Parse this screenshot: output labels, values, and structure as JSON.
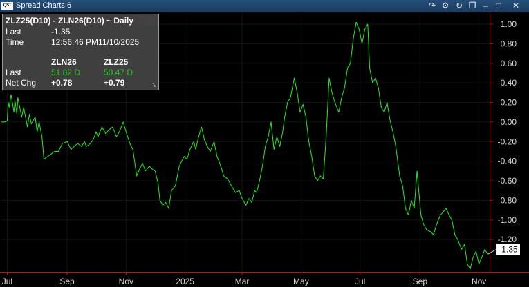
{
  "window": {
    "logo": "QST",
    "title": "Spread Charts 6",
    "icons": [
      "link-icon",
      "gear-icon",
      "refresh-icon",
      "copy-icon",
      "minimize-icon",
      "maximize-icon",
      "close-icon"
    ]
  },
  "info_panel": {
    "title": "ZLZ25(D10) - ZLN26(D10) ~ Daily",
    "last_label": "Last",
    "last_value": "-1.35",
    "time_label": "Time",
    "time_value": "12:56:46 PM11/10/2025",
    "col1_header": "ZLN26",
    "col2_header": "ZLZ25",
    "row_last_label": "Last",
    "col1_last": "51.82 D",
    "col2_last": "50.47 D",
    "row_netchg_label": "Net Chg",
    "col1_netchg": "+0.78",
    "col2_netchg": "+0.79"
  },
  "colors": {
    "background": "#000000",
    "line": "#22ee22",
    "axis": "#b01818",
    "label": "#d8d8d8",
    "grid": "#141414"
  },
  "chart_data": {
    "type": "line",
    "y_axis_side": "right",
    "ylim": [
      -1.53,
      1.12
    ],
    "yticks": [
      "1.00",
      "0.80",
      "0.60",
      "0.40",
      "0.20",
      "0.00",
      "-0.20",
      "-0.40",
      "-0.60",
      "-0.80",
      "-1.00",
      "-1.20"
    ],
    "ytick_values": [
      1.0,
      0.8,
      0.6,
      0.4,
      0.2,
      0.0,
      -0.2,
      -0.4,
      -0.6,
      -0.8,
      -1.0,
      -1.2
    ],
    "x_range": [
      "2024-06-25",
      "2025-11-12"
    ],
    "xticks": [
      {
        "label": "Jul",
        "date": "2024-07-01"
      },
      {
        "label": "Sep",
        "date": "2024-09-01"
      },
      {
        "label": "Nov",
        "date": "2024-11-01"
      },
      {
        "label": "2025",
        "date": "2025-01-01"
      },
      {
        "label": "Mar",
        "date": "2025-03-01"
      },
      {
        "label": "May",
        "date": "2025-05-01"
      },
      {
        "label": "Jul",
        "date": "2025-07-01"
      },
      {
        "label": "Sep",
        "date": "2025-09-01"
      },
      {
        "label": "Nov",
        "date": "2025-11-01"
      }
    ],
    "last_label": "-1.35",
    "last_value": -1.35,
    "series": [
      {
        "points": [
          [
            "2024-06-25",
            0.0
          ],
          [
            "2024-06-28",
            0.0
          ],
          [
            "2024-07-01",
            0.01
          ],
          [
            "2024-07-02",
            0.2
          ],
          [
            "2024-07-03",
            0.15
          ],
          [
            "2024-07-05",
            0.28
          ],
          [
            "2024-07-08",
            0.1
          ],
          [
            "2024-07-09",
            0.22
          ],
          [
            "2024-07-11",
            0.08
          ],
          [
            "2024-07-12",
            0.25
          ],
          [
            "2024-07-16",
            0.05
          ],
          [
            "2024-07-18",
            0.15
          ],
          [
            "2024-07-22",
            -0.05
          ],
          [
            "2024-07-24",
            0.08
          ],
          [
            "2024-07-26",
            -0.02
          ],
          [
            "2024-07-30",
            0.05
          ],
          [
            "2024-08-01",
            -0.1
          ],
          [
            "2024-08-03",
            0.0
          ],
          [
            "2024-08-06",
            -0.15
          ],
          [
            "2024-08-08",
            -0.38
          ],
          [
            "2024-08-12",
            -0.35
          ],
          [
            "2024-08-15",
            -0.33
          ],
          [
            "2024-08-19",
            -0.3
          ],
          [
            "2024-08-23",
            -0.3
          ],
          [
            "2024-08-27",
            -0.22
          ],
          [
            "2024-09-01",
            -0.2
          ],
          [
            "2024-09-05",
            -0.28
          ],
          [
            "2024-09-08",
            -0.25
          ],
          [
            "2024-09-12",
            -0.22
          ],
          [
            "2024-09-16",
            -0.25
          ],
          [
            "2024-09-19",
            -0.2
          ],
          [
            "2024-09-21",
            -0.25
          ],
          [
            "2024-09-25",
            -0.22
          ],
          [
            "2024-09-28",
            -0.18
          ],
          [
            "2024-10-01",
            -0.1
          ],
          [
            "2024-10-03",
            -0.15
          ],
          [
            "2024-10-07",
            -0.05
          ],
          [
            "2024-10-11",
            -0.12
          ],
          [
            "2024-10-14",
            -0.08
          ],
          [
            "2024-10-18",
            -0.05
          ],
          [
            "2024-10-22",
            -0.15
          ],
          [
            "2024-10-25",
            -0.1
          ],
          [
            "2024-10-29",
            0.0
          ],
          [
            "2024-11-01",
            -0.1
          ],
          [
            "2024-11-05",
            -0.22
          ],
          [
            "2024-11-08",
            -0.28
          ],
          [
            "2024-11-12",
            -0.55
          ],
          [
            "2024-11-15",
            -0.48
          ],
          [
            "2024-11-18",
            -0.42
          ],
          [
            "2024-11-21",
            -0.5
          ],
          [
            "2024-11-25",
            -0.45
          ],
          [
            "2024-11-28",
            -0.48
          ],
          [
            "2024-12-01",
            -0.5
          ],
          [
            "2024-12-04",
            -0.62
          ],
          [
            "2024-12-06",
            -0.8
          ],
          [
            "2024-12-09",
            -0.85
          ],
          [
            "2024-12-12",
            -0.82
          ],
          [
            "2024-12-15",
            -0.88
          ],
          [
            "2024-12-18",
            -0.7
          ],
          [
            "2024-12-22",
            -0.65
          ],
          [
            "2024-12-26",
            -0.45
          ],
          [
            "2024-12-31",
            -0.35
          ],
          [
            "2025-01-03",
            -0.38
          ],
          [
            "2025-01-06",
            -0.28
          ],
          [
            "2025-01-10",
            -0.2
          ],
          [
            "2025-01-12",
            -0.28
          ],
          [
            "2025-01-15",
            -0.15
          ],
          [
            "2025-01-18",
            -0.05
          ],
          [
            "2025-01-21",
            -0.18
          ],
          [
            "2025-01-24",
            -0.25
          ],
          [
            "2025-01-27",
            -0.3
          ],
          [
            "2025-01-31",
            -0.2
          ],
          [
            "2025-02-03",
            -0.35
          ],
          [
            "2025-02-07",
            -0.45
          ],
          [
            "2025-02-10",
            -0.55
          ],
          [
            "2025-02-14",
            -0.58
          ],
          [
            "2025-02-18",
            -0.65
          ],
          [
            "2025-02-22",
            -0.72
          ],
          [
            "2025-02-26",
            -0.7
          ],
          [
            "2025-03-01",
            -0.78
          ],
          [
            "2025-03-05",
            -0.85
          ],
          [
            "2025-03-08",
            -0.78
          ],
          [
            "2025-03-11",
            -0.82
          ],
          [
            "2025-03-14",
            -0.7
          ],
          [
            "2025-03-16",
            -0.72
          ],
          [
            "2025-03-19",
            -0.6
          ],
          [
            "2025-03-22",
            -0.45
          ],
          [
            "2025-03-25",
            -0.25
          ],
          [
            "2025-03-28",
            -0.15
          ],
          [
            "2025-03-31",
            0.0
          ],
          [
            "2025-04-03",
            -0.28
          ],
          [
            "2025-04-06",
            -0.15
          ],
          [
            "2025-04-09",
            -0.25
          ],
          [
            "2025-04-12",
            -0.1
          ],
          [
            "2025-04-14",
            0.05
          ],
          [
            "2025-04-17",
            0.2
          ],
          [
            "2025-04-20",
            0.25
          ],
          [
            "2025-04-24",
            0.45
          ],
          [
            "2025-04-27",
            0.3
          ],
          [
            "2025-04-30",
            0.1
          ],
          [
            "2025-05-03",
            0.18
          ],
          [
            "2025-05-06",
            0.05
          ],
          [
            "2025-05-09",
            -0.2
          ],
          [
            "2025-05-12",
            -0.35
          ],
          [
            "2025-05-15",
            -0.55
          ],
          [
            "2025-05-18",
            -0.6
          ],
          [
            "2025-05-21",
            -0.55
          ],
          [
            "2025-05-24",
            -0.58
          ],
          [
            "2025-05-27",
            -0.15
          ],
          [
            "2025-05-30",
            0.45
          ],
          [
            "2025-06-02",
            0.3
          ],
          [
            "2025-06-05",
            0.2
          ],
          [
            "2025-06-09",
            0.1
          ],
          [
            "2025-06-12",
            0.25
          ],
          [
            "2025-06-15",
            0.35
          ],
          [
            "2025-06-18",
            0.55
          ],
          [
            "2025-06-21",
            0.6
          ],
          [
            "2025-06-24",
            0.85
          ],
          [
            "2025-06-27",
            1.02
          ],
          [
            "2025-06-30",
            0.95
          ],
          [
            "2025-07-03",
            0.8
          ],
          [
            "2025-07-06",
            0.95
          ],
          [
            "2025-07-09",
            1.0
          ],
          [
            "2025-07-11",
            0.55
          ],
          [
            "2025-07-14",
            0.4
          ],
          [
            "2025-07-17",
            0.45
          ],
          [
            "2025-07-20",
            0.35
          ],
          [
            "2025-07-23",
            0.15
          ],
          [
            "2025-07-26",
            0.1
          ],
          [
            "2025-07-29",
            0.2
          ],
          [
            "2025-08-01",
            0.02
          ],
          [
            "2025-08-04",
            -0.1
          ],
          [
            "2025-08-07",
            -0.25
          ],
          [
            "2025-08-11",
            -0.55
          ],
          [
            "2025-08-14",
            -0.65
          ],
          [
            "2025-08-17",
            -0.88
          ],
          [
            "2025-08-20",
            -0.95
          ],
          [
            "2025-08-23",
            -0.8
          ],
          [
            "2025-08-26",
            -0.88
          ],
          [
            "2025-08-29",
            -0.5
          ],
          [
            "2025-09-02",
            -0.95
          ],
          [
            "2025-09-05",
            -1.05
          ],
          [
            "2025-09-08",
            -1.1
          ],
          [
            "2025-09-12",
            -1.12
          ],
          [
            "2025-09-15",
            -1.15
          ],
          [
            "2025-09-18",
            -1.05
          ],
          [
            "2025-09-22",
            -0.95
          ],
          [
            "2025-09-25",
            -0.92
          ],
          [
            "2025-09-28",
            -0.88
          ],
          [
            "2025-10-01",
            -0.95
          ],
          [
            "2025-10-04",
            -1.0
          ],
          [
            "2025-10-07",
            -1.15
          ],
          [
            "2025-10-10",
            -1.2
          ],
          [
            "2025-10-14",
            -1.3
          ],
          [
            "2025-10-17",
            -1.25
          ],
          [
            "2025-10-20",
            -1.45
          ],
          [
            "2025-10-23",
            -1.5
          ],
          [
            "2025-10-26",
            -1.38
          ],
          [
            "2025-10-29",
            -1.32
          ],
          [
            "2025-11-01",
            -1.45
          ],
          [
            "2025-11-04",
            -1.38
          ],
          [
            "2025-11-07",
            -1.3
          ],
          [
            "2025-11-10",
            -1.35
          ]
        ]
      }
    ]
  }
}
